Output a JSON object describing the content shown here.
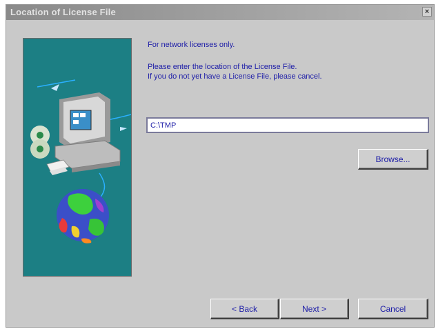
{
  "window": {
    "title": "Location of License File",
    "close_label": "×"
  },
  "content": {
    "line1": "For network licenses only.",
    "line2": "Please enter the location of the License File.",
    "line3": "If you do not yet have a License File, please cancel."
  },
  "path_field": {
    "value": "C:\\TMP"
  },
  "buttons": {
    "browse": "Browse...",
    "back": "< Back",
    "next": "Next >",
    "cancel": "Cancel"
  },
  "art": {
    "icons": [
      "computer-icon",
      "compact-disc-icon",
      "floppy-disk-icon",
      "globe-icon"
    ],
    "colors": {
      "background": "#1c7f84",
      "cable": "#2ab0ff"
    }
  }
}
